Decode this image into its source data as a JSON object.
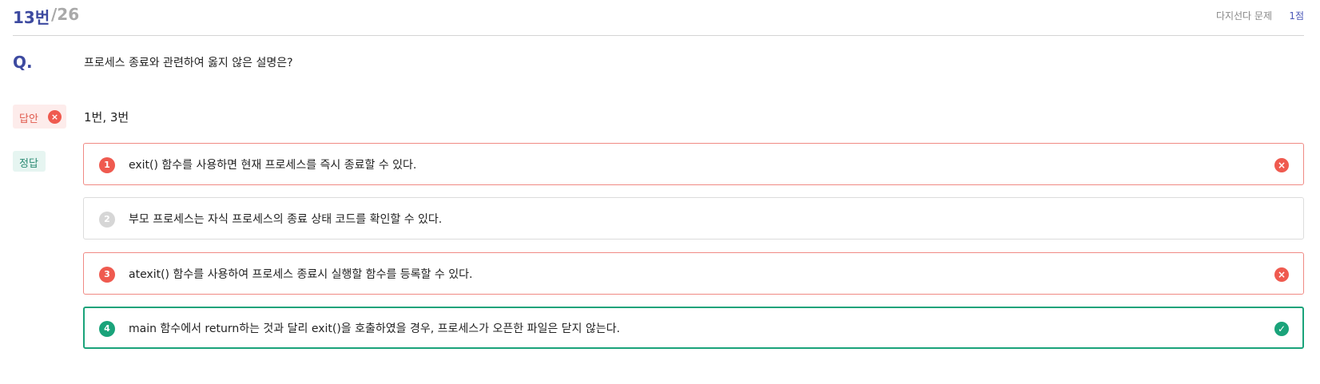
{
  "header": {
    "question_number": "13번",
    "total": "/26",
    "type": "다지선다 문제",
    "points": "1점"
  },
  "question": {
    "label": "Q.",
    "text": "프로세스 종료와 관련하여 옳지 않은 설명은?"
  },
  "answer": {
    "label": "답안",
    "status_icon": "×",
    "value": "1번, 3번"
  },
  "correct": {
    "label": "정답"
  },
  "options": [
    {
      "num": "1",
      "text": "exit() 함수를 사용하면 현재 프로세스를 즉시 종료할 수 있다.",
      "state": "wrong",
      "status_icon": "×"
    },
    {
      "num": "2",
      "text": "부모 프로세스는 자식 프로세스의 종료 상태 코드를 확인할 수 있다.",
      "state": "none",
      "status_icon": ""
    },
    {
      "num": "3",
      "text": "atexit() 함수를 사용하여 프로세스 종료시 실행할 함수를 등록할 수 있다.",
      "state": "wrong",
      "status_icon": "×"
    },
    {
      "num": "4",
      "text": "main 함수에서 return하는 것과 달리 exit()을 호출하였을 경우, 프로세스가 오픈한 파일은 닫지 않는다.",
      "state": "correct",
      "status_icon": "✓"
    }
  ],
  "colors": {
    "brand": "#3d4aa0",
    "wrong": "#ef5a4f",
    "correct": "#1aa37a",
    "neutral": "#d6d6d6"
  }
}
